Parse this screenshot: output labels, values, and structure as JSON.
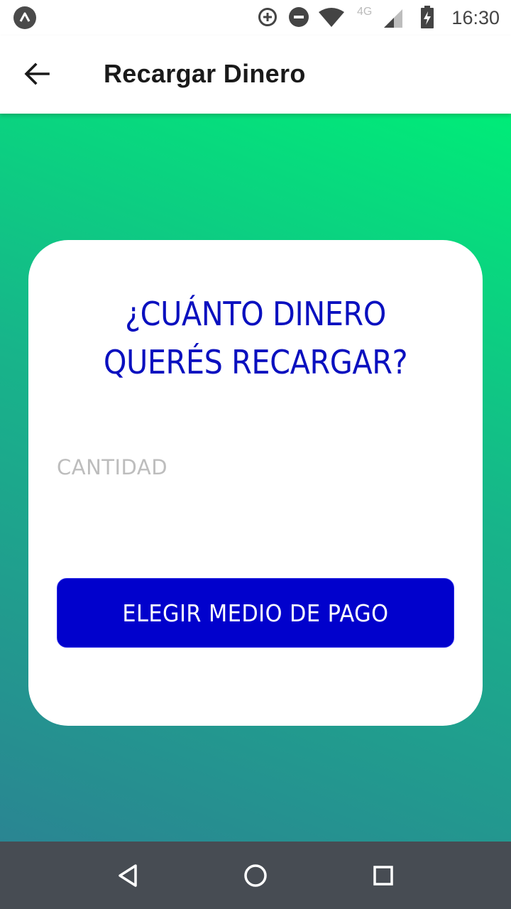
{
  "status_bar": {
    "time": "16:30",
    "network_label": "4G",
    "icons": [
      "notification-app-icon",
      "data-saver-icon",
      "do-not-disturb-icon",
      "wifi-icon",
      "signal-icon",
      "battery-charging-icon"
    ]
  },
  "app_bar": {
    "back_icon": "arrow-left-icon",
    "title": "Recargar Dinero"
  },
  "colors": {
    "gradient_top": "#00ec78",
    "gradient_bottom": "#2a8592",
    "accent_blue": "#0101cc",
    "question_blue": "#0a10bf",
    "nav_bar": "#474c53"
  },
  "card": {
    "question_line1": "¿CUÁNTO DINERO",
    "question_line2": "QUERÉS RECARGAR?",
    "amount_field": {
      "placeholder": "CANTIDAD",
      "value": ""
    },
    "pay_button_label": "ELEGIR MEDIO DE PAGO"
  },
  "nav_bar": {
    "icons": [
      "back-triangle-icon",
      "home-circle-icon",
      "recents-square-icon"
    ]
  }
}
